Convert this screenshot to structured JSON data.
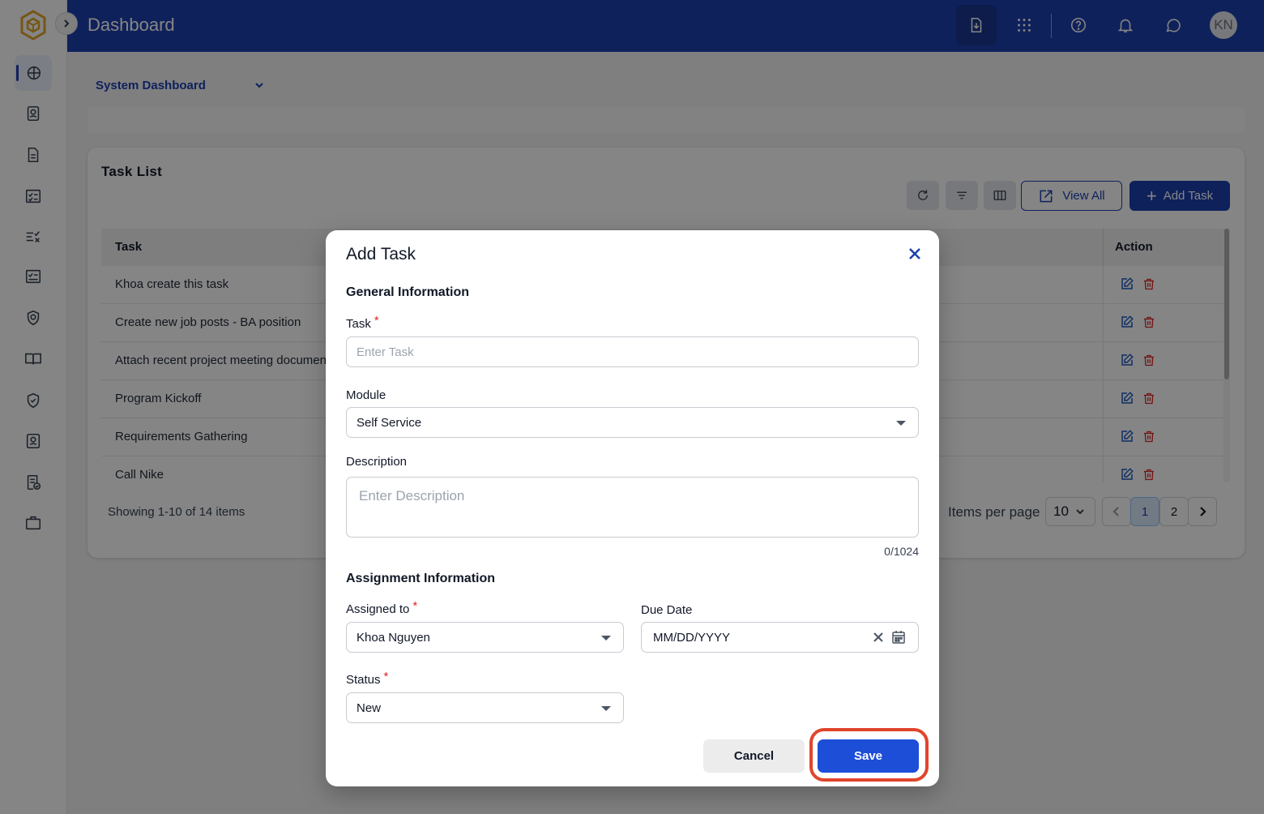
{
  "header": {
    "title": "Dashboard",
    "avatar_initials": "KN",
    "icons": [
      "export-icon",
      "apps-grid-icon",
      "help-icon",
      "bell-icon",
      "chat-icon"
    ]
  },
  "sidebar": {
    "icons": [
      "dashboard-icon",
      "contacts-icon",
      "document-icon",
      "checklist-icon",
      "tasks-icon",
      "review-icon",
      "privacy-icon",
      "book-icon",
      "shield-icon",
      "profile-icon",
      "policy-icon",
      "briefcase-icon"
    ]
  },
  "dashboard_select": {
    "value": "System Dashboard"
  },
  "task_list": {
    "title": "Task List",
    "view_all_label": "View All",
    "add_task_label": "Add Task",
    "columns": {
      "task": "Task",
      "action": "Action"
    },
    "rows": [
      "Khoa create this task",
      "Create new job posts - BA position",
      "Attach recent project meeting document",
      "Program Kickoff",
      "Requirements Gathering",
      "Call Nike"
    ],
    "showing": "Showing 1-10 of 14 items",
    "items_per_page_label": "Items per page",
    "items_per_page_value": "10",
    "pages": [
      "1",
      "2"
    ],
    "current_page": "1"
  },
  "modal": {
    "title": "Add Task",
    "general_section": "General Information",
    "task_label": "Task",
    "task_placeholder": "Enter Task",
    "module_label": "Module",
    "module_value": "Self Service",
    "description_label": "Description",
    "description_placeholder": "Enter Description",
    "char_counter": "0/1024",
    "assignment_section": "Assignment Information",
    "assigned_label": "Assigned to",
    "assigned_value": "Khoa Nguyen",
    "due_label": "Due Date",
    "due_placeholder": "MM/DD/YYYY",
    "status_label": "Status",
    "status_value": "New",
    "required_marker": "*",
    "cancel_label": "Cancel",
    "save_label": "Save"
  },
  "colors": {
    "primary": "#1e40af",
    "save_button": "#1d4ed8",
    "highlight": "#e0452c",
    "required": "#dc2626"
  }
}
